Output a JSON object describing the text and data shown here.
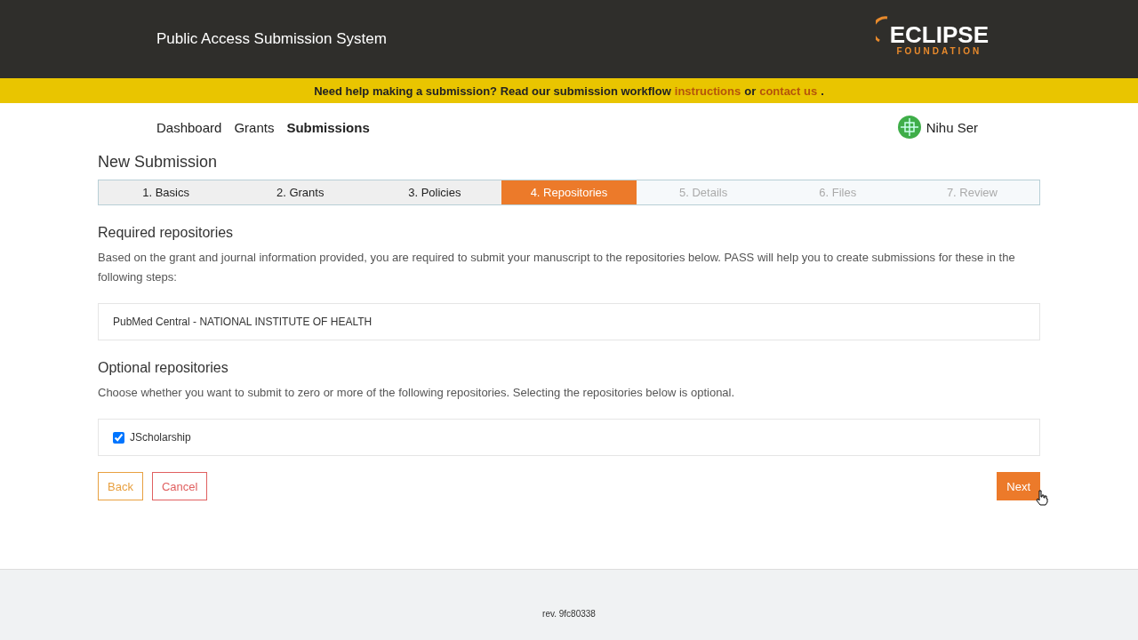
{
  "header": {
    "title": "Public Access Submission System",
    "logo": {
      "main": "ECLIPSE",
      "sub": "FOUNDATION"
    }
  },
  "banner": {
    "text": "Need help making a submission? Read our submission workflow",
    "link1": "instructions",
    "middle": "or",
    "link2": "contact us",
    "end": "."
  },
  "nav": {
    "items": [
      {
        "label": "Dashboard",
        "selected": false
      },
      {
        "label": "Grants",
        "selected": false
      },
      {
        "label": "Submissions",
        "selected": true
      }
    ],
    "user": "Nihu Ser"
  },
  "page_title": "New Submission",
  "steps": [
    {
      "label": "1. Basics",
      "selected": false,
      "disabled": false
    },
    {
      "label": "2. Grants",
      "selected": false,
      "disabled": false
    },
    {
      "label": "3. Policies",
      "selected": false,
      "disabled": false
    },
    {
      "label": "4. Repositories",
      "selected": true,
      "disabled": false
    },
    {
      "label": "5. Details",
      "selected": false,
      "disabled": true
    },
    {
      "label": "6. Files",
      "selected": false,
      "disabled": true
    },
    {
      "label": "7. Review",
      "selected": false,
      "disabled": true
    }
  ],
  "required": {
    "heading": "Required repositories",
    "text": "Based on the grant and journal information provided, you are required to submit your manuscript to the repositories below. PASS will help you to create submissions for these in the following steps:",
    "items": [
      "PubMed Central - NATIONAL INSTITUTE OF HEALTH"
    ]
  },
  "optional": {
    "heading": "Optional repositories",
    "text": "Choose whether you want to submit to zero or more of the following repositories. Selecting the repositories below is optional.",
    "items": [
      {
        "label": "JScholarship",
        "checked": true
      }
    ]
  },
  "buttons": {
    "back": "Back",
    "cancel": "Cancel",
    "next": "Next"
  },
  "footer": {
    "text": "rev. 9fc80338"
  }
}
